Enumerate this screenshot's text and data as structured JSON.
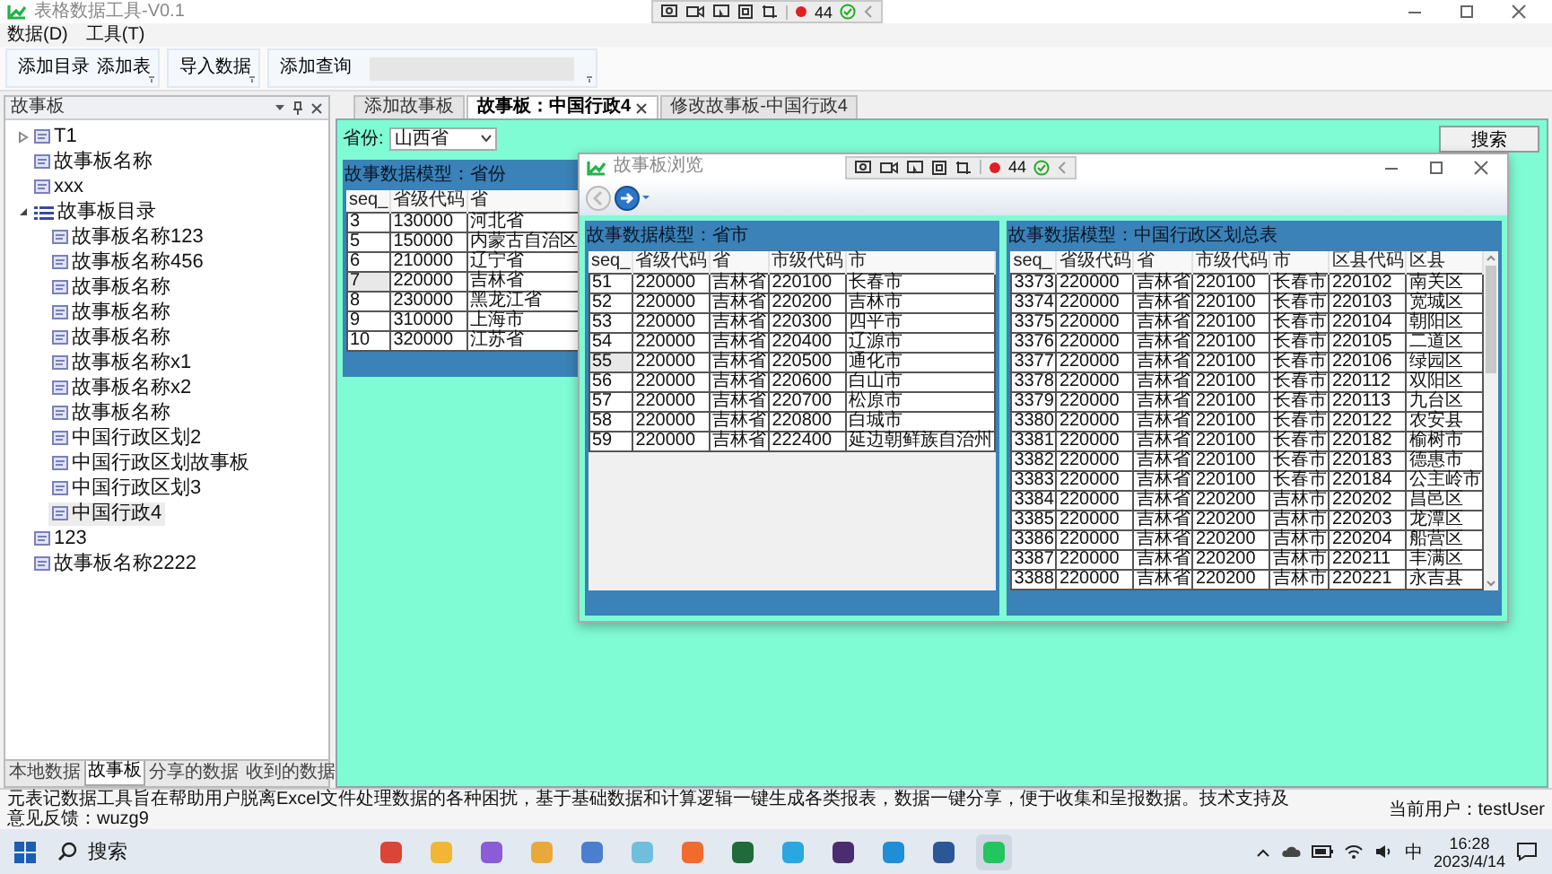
{
  "window": {
    "title": "表格数据工具-V0.1"
  },
  "recorder_toolbars": [
    {
      "count": "44"
    },
    {
      "count": "44"
    }
  ],
  "menu": [
    {
      "label": "数据(D)"
    },
    {
      "label": "工具(T)"
    }
  ],
  "ribbon_groups": [
    {
      "kind": "buttons",
      "buttons": [
        "添加目录",
        "添加表"
      ]
    },
    {
      "kind": "buttons",
      "buttons": [
        "导入数据"
      ]
    },
    {
      "kind": "query",
      "buttons": [
        "添加查询"
      ]
    }
  ],
  "sidebar": {
    "title": "故事板",
    "tree": [
      {
        "label": "T1",
        "kind": "board",
        "expanded": false,
        "selected": false
      },
      {
        "label": "故事板名称",
        "kind": "board",
        "selected": false
      },
      {
        "label": "xxx",
        "kind": "board",
        "selected": false
      },
      {
        "label": "故事板目录",
        "kind": "catalog",
        "expanded": true,
        "selected": false,
        "children": [
          {
            "label": "故事板名称123",
            "kind": "board",
            "selected": false
          },
          {
            "label": "故事板名称456",
            "kind": "board",
            "selected": false
          },
          {
            "label": "故事板名称",
            "kind": "board",
            "selected": false
          },
          {
            "label": "故事板名称",
            "kind": "board",
            "selected": false
          },
          {
            "label": "故事板名称",
            "kind": "board",
            "selected": false
          },
          {
            "label": "故事板名称x1",
            "kind": "board",
            "selected": false
          },
          {
            "label": "故事板名称x2",
            "kind": "board",
            "selected": false
          },
          {
            "label": "故事板名称",
            "kind": "board",
            "selected": false
          },
          {
            "label": "中国行政区划2",
            "kind": "board",
            "selected": false
          },
          {
            "label": "中国行政区划故事板",
            "kind": "board",
            "selected": false
          },
          {
            "label": "中国行政区划3",
            "kind": "board",
            "selected": false
          },
          {
            "label": "中国行政4",
            "kind": "board",
            "selected": true
          }
        ]
      },
      {
        "label": "123",
        "kind": "board",
        "selected": false
      },
      {
        "label": "故事板名称2222",
        "kind": "board",
        "selected": false
      }
    ],
    "tabs": [
      {
        "label": "本地数据",
        "selected": false
      },
      {
        "label": "故事板",
        "selected": true
      },
      {
        "label": "分享的数据",
        "selected": false
      },
      {
        "label": "收到的数据",
        "selected": false
      }
    ]
  },
  "doc_tabs": [
    {
      "label": "添加故事板",
      "selected": false,
      "closable": false
    },
    {
      "label": "故事板：中国行政4",
      "selected": true,
      "closable": true
    },
    {
      "label": "修改故事板-中国行政4",
      "selected": false,
      "closable": false
    }
  ],
  "filter": {
    "label": "省份:",
    "value": "山西省"
  },
  "search_button": "搜索",
  "table": {
    "title": "故事数据模型：省份",
    "columns": [
      "seq_",
      "省级代码",
      "省"
    ],
    "rows": [
      {
        "cells": [
          "3",
          "130000",
          "河北省"
        ],
        "selected": false
      },
      {
        "cells": [
          "5",
          "150000",
          "内蒙古自治区"
        ],
        "selected": false
      },
      {
        "cells": [
          "6",
          "210000",
          "辽宁省"
        ],
        "selected": false
      },
      {
        "cells": [
          "7",
          "220000",
          "吉林省"
        ],
        "selected": true
      },
      {
        "cells": [
          "8",
          "230000",
          "黑龙江省"
        ],
        "selected": false
      },
      {
        "cells": [
          "9",
          "310000",
          "上海市"
        ],
        "selected": false
      },
      {
        "cells": [
          "10",
          "320000",
          "江苏省"
        ],
        "selected": false
      }
    ]
  },
  "dialog": {
    "title": "故事板浏览",
    "panels": [
      {
        "title": "故事数据模型：省市",
        "columns": [
          "seq_",
          "省级代码",
          "省",
          "市级代码",
          "市"
        ],
        "rows": [
          {
            "cells": [
              "51",
              "220000",
              "吉林省",
              "220100",
              "长春市"
            ],
            "selected": false
          },
          {
            "cells": [
              "52",
              "220000",
              "吉林省",
              "220200",
              "吉林市"
            ],
            "selected": false
          },
          {
            "cells": [
              "53",
              "220000",
              "吉林省",
              "220300",
              "四平市"
            ],
            "selected": false
          },
          {
            "cells": [
              "54",
              "220000",
              "吉林省",
              "220400",
              "辽源市"
            ],
            "selected": false
          },
          {
            "cells": [
              "55",
              "220000",
              "吉林省",
              "220500",
              "通化市"
            ],
            "selected": true
          },
          {
            "cells": [
              "56",
              "220000",
              "吉林省",
              "220600",
              "白山市"
            ],
            "selected": false
          },
          {
            "cells": [
              "57",
              "220000",
              "吉林省",
              "220700",
              "松原市"
            ],
            "selected": false
          },
          {
            "cells": [
              "58",
              "220000",
              "吉林省",
              "220800",
              "白城市"
            ],
            "selected": false
          },
          {
            "cells": [
              "59",
              "220000",
              "吉林省",
              "222400",
              "延边朝鲜族自治州"
            ],
            "selected": false
          }
        ]
      },
      {
        "title": "故事数据模型：中国行政区划总表",
        "columns": [
          "seq_",
          "省级代码",
          "省",
          "市级代码",
          "市",
          "区县代码",
          "区县"
        ],
        "rows": [
          {
            "cells": [
              "3373",
              "220000",
              "吉林省",
              "220100",
              "长春市",
              "220102",
              "南关区"
            ],
            "selected": false
          },
          {
            "cells": [
              "3374",
              "220000",
              "吉林省",
              "220100",
              "长春市",
              "220103",
              "宽城区"
            ],
            "selected": false
          },
          {
            "cells": [
              "3375",
              "220000",
              "吉林省",
              "220100",
              "长春市",
              "220104",
              "朝阳区"
            ],
            "selected": false
          },
          {
            "cells": [
              "3376",
              "220000",
              "吉林省",
              "220100",
              "长春市",
              "220105",
              "二道区"
            ],
            "selected": false
          },
          {
            "cells": [
              "3377",
              "220000",
              "吉林省",
              "220100",
              "长春市",
              "220106",
              "绿园区"
            ],
            "selected": false
          },
          {
            "cells": [
              "3378",
              "220000",
              "吉林省",
              "220100",
              "长春市",
              "220112",
              "双阳区"
            ],
            "selected": false
          },
          {
            "cells": [
              "3379",
              "220000",
              "吉林省",
              "220100",
              "长春市",
              "220113",
              "九台区"
            ],
            "selected": false
          },
          {
            "cells": [
              "3380",
              "220000",
              "吉林省",
              "220100",
              "长春市",
              "220122",
              "农安县"
            ],
            "selected": false
          },
          {
            "cells": [
              "3381",
              "220000",
              "吉林省",
              "220100",
              "长春市",
              "220182",
              "榆树市"
            ],
            "selected": false
          },
          {
            "cells": [
              "3382",
              "220000",
              "吉林省",
              "220100",
              "长春市",
              "220183",
              "德惠市"
            ],
            "selected": false
          },
          {
            "cells": [
              "3383",
              "220000",
              "吉林省",
              "220100",
              "长春市",
              "220184",
              "公主岭市"
            ],
            "selected": false
          },
          {
            "cells": [
              "3384",
              "220000",
              "吉林省",
              "220200",
              "吉林市",
              "220202",
              "昌邑区"
            ],
            "selected": false
          },
          {
            "cells": [
              "3385",
              "220000",
              "吉林省",
              "220200",
              "吉林市",
              "220203",
              "龙潭区"
            ],
            "selected": false
          },
          {
            "cells": [
              "3386",
              "220000",
              "吉林省",
              "220200",
              "吉林市",
              "220204",
              "船营区"
            ],
            "selected": false
          },
          {
            "cells": [
              "3387",
              "220000",
              "吉林省",
              "220200",
              "吉林市",
              "220211",
              "丰满区"
            ],
            "selected": false
          },
          {
            "cells": [
              "3388",
              "220000",
              "吉林省",
              "220200",
              "吉林市",
              "220221",
              "永吉县"
            ],
            "selected": false
          }
        ]
      }
    ]
  },
  "status_bar": {
    "message": "元表记数据工具旨在帮助用户脱离Excel文件处理数据的各种困扰，基于基础数据和计算逻辑一键生成各类报表，数据一键分享，便于收集和呈报数据。技术支持及意见反馈：wuzg9",
    "user": "当前用户：testUser"
  },
  "taskbar": {
    "search": {
      "placeholder": "搜索"
    },
    "apps": [
      {
        "color": "#db4437",
        "selected": false
      },
      {
        "color": "#f2b632",
        "selected": false
      },
      {
        "color": "#8a5cd6",
        "selected": false
      },
      {
        "color": "#e8a93a",
        "selected": false
      },
      {
        "color": "#4a7fd0",
        "selected": false
      },
      {
        "color": "#6fbfdc",
        "selected": false
      },
      {
        "color": "#f26a2e",
        "selected": false
      },
      {
        "color": "#1f6b3a",
        "selected": false
      },
      {
        "color": "#2aa7e0",
        "selected": false
      },
      {
        "color": "#4b2c6e",
        "selected": false
      },
      {
        "color": "#1e8fd6",
        "selected": false
      },
      {
        "color": "#2b5797",
        "selected": false
      },
      {
        "color": "#22c55e",
        "selected": true
      }
    ],
    "ime": "中",
    "time": "16:28",
    "date": "2023/4/14"
  }
}
